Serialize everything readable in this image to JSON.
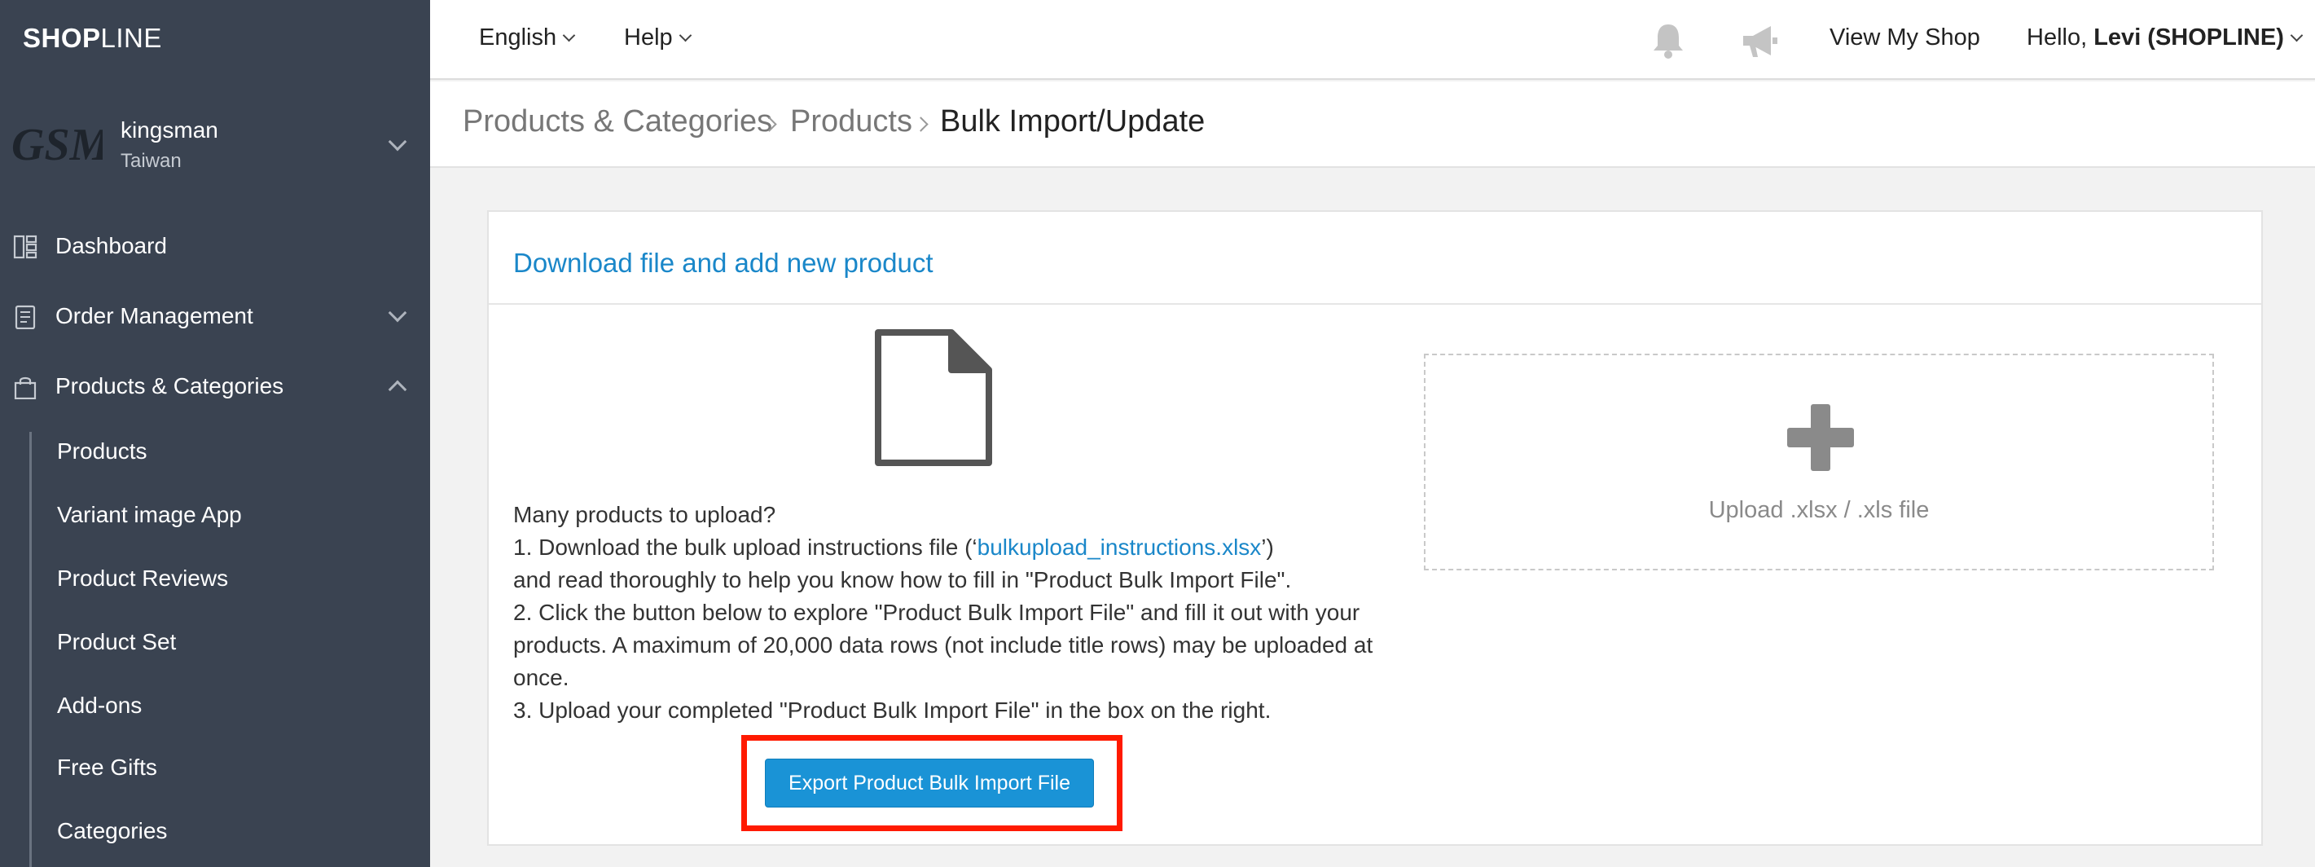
{
  "brand": {
    "logo_bold": "SHOP",
    "logo_light": "LINE"
  },
  "shop": {
    "logo_text": "GSM",
    "name": "kingsman",
    "region": "Taiwan"
  },
  "sidebar": {
    "items": [
      {
        "label": "Dashboard",
        "icon": "dashboard-icon"
      },
      {
        "label": "Order Management",
        "icon": "clipboard-icon",
        "expanded": false
      },
      {
        "label": "Products & Categories",
        "icon": "shopping-bag-icon",
        "expanded": true
      }
    ],
    "sub_items": [
      {
        "label": "Products"
      },
      {
        "label": "Variant image App"
      },
      {
        "label": "Product Reviews"
      },
      {
        "label": "Product Set"
      },
      {
        "label": "Add-ons"
      },
      {
        "label": "Free Gifts"
      },
      {
        "label": "Categories"
      }
    ]
  },
  "header": {
    "language": "English",
    "help": "Help",
    "view_shop": "View My Shop",
    "greeting": "Hello,",
    "user": "Levi (SHOPLINE)"
  },
  "breadcrumb": [
    "Products & Categories",
    "Products",
    "Bulk Import/Update"
  ],
  "panel": {
    "title": "Download file and add new product",
    "intro": "Many products to upload?",
    "step1_prefix": "1. Download the bulk upload instructions file (‘",
    "step1_link": "bulkupload_instructions.xlsx",
    "step1_suffix": "’)",
    "step1_rest": "and read thoroughly to help you know how to fill in \"Product Bulk Import File\".",
    "step2": "2. Click the button below to explore \"Product Bulk Import File\" and fill it out with your products. A maximum of 20,000 data rows (not include title rows) may be uploaded at once.",
    "step3": "3. Upload your completed \"Product Bulk Import File\" in the box on the right.",
    "export_button": "Export Product Bulk Import File",
    "upload_label": "Upload .xlsx / .xls file"
  },
  "colors": {
    "sidebar_bg": "#3a4351",
    "accent": "#1a87c9",
    "button": "#1a93d6",
    "highlight": "#ff1a00"
  }
}
